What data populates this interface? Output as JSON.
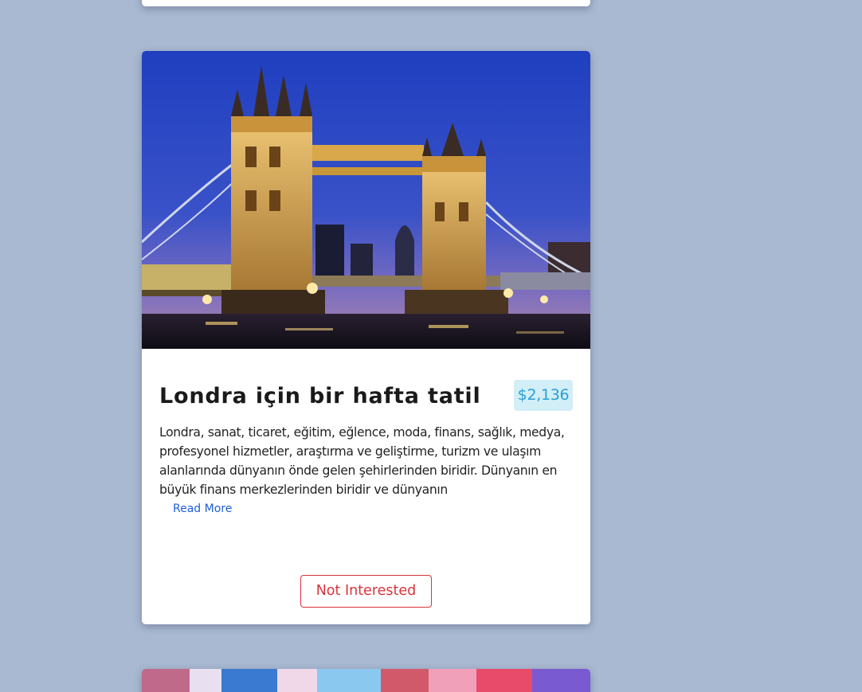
{
  "tour": {
    "title": "Londra için bir hafta tatil",
    "price": "$2,136",
    "description": "Londra, sanat, ticaret, eğitim, eğlence, moda, finans, sağlık, medya, profesyonel hizmetler, araştırma ve geliştirme, turizm ve ulaşım alanlarında dünyanın önde gelen şehirlerinden biridir. Dünyanın en büyük finans merkezlerinden biridir ve dünyanın",
    "read_more_label": "Read More",
    "not_interested_label": "Not Interested"
  },
  "colors": {
    "page_background": "#a9b9d1",
    "price_badge_bg": "#d2eef6",
    "price_text": "#2a9fd6",
    "link": "#1f5fd6",
    "danger": "#d9343a"
  }
}
